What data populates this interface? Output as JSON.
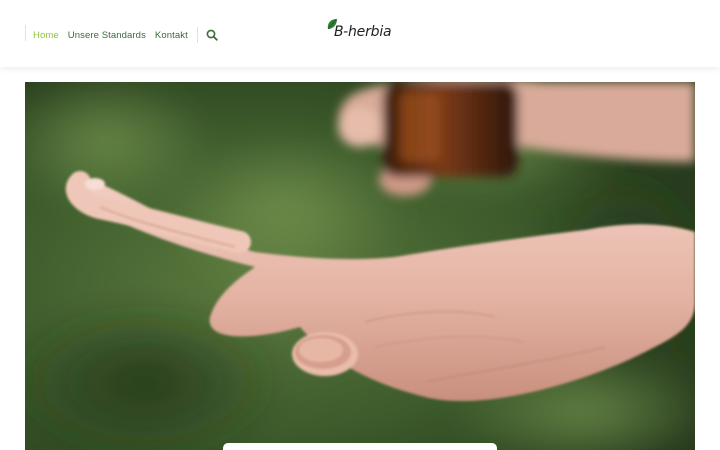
{
  "nav": {
    "items": [
      {
        "label": "Home",
        "active": true
      },
      {
        "label": "Unsere Standards",
        "active": false
      },
      {
        "label": "Kontakt",
        "active": false
      }
    ],
    "search_icon": "search-icon"
  },
  "logo": {
    "text": "B-herbia",
    "leaf_icon": "leaf-icon"
  },
  "hero": {
    "image_subject": "hand-receiving-oil-drop-photo"
  },
  "colors": {
    "nav_active": "#8cc63f",
    "nav_text": "#3a6b3a",
    "leaf_green": "#2f7d32",
    "hero_bg": "#3d5a2c"
  }
}
